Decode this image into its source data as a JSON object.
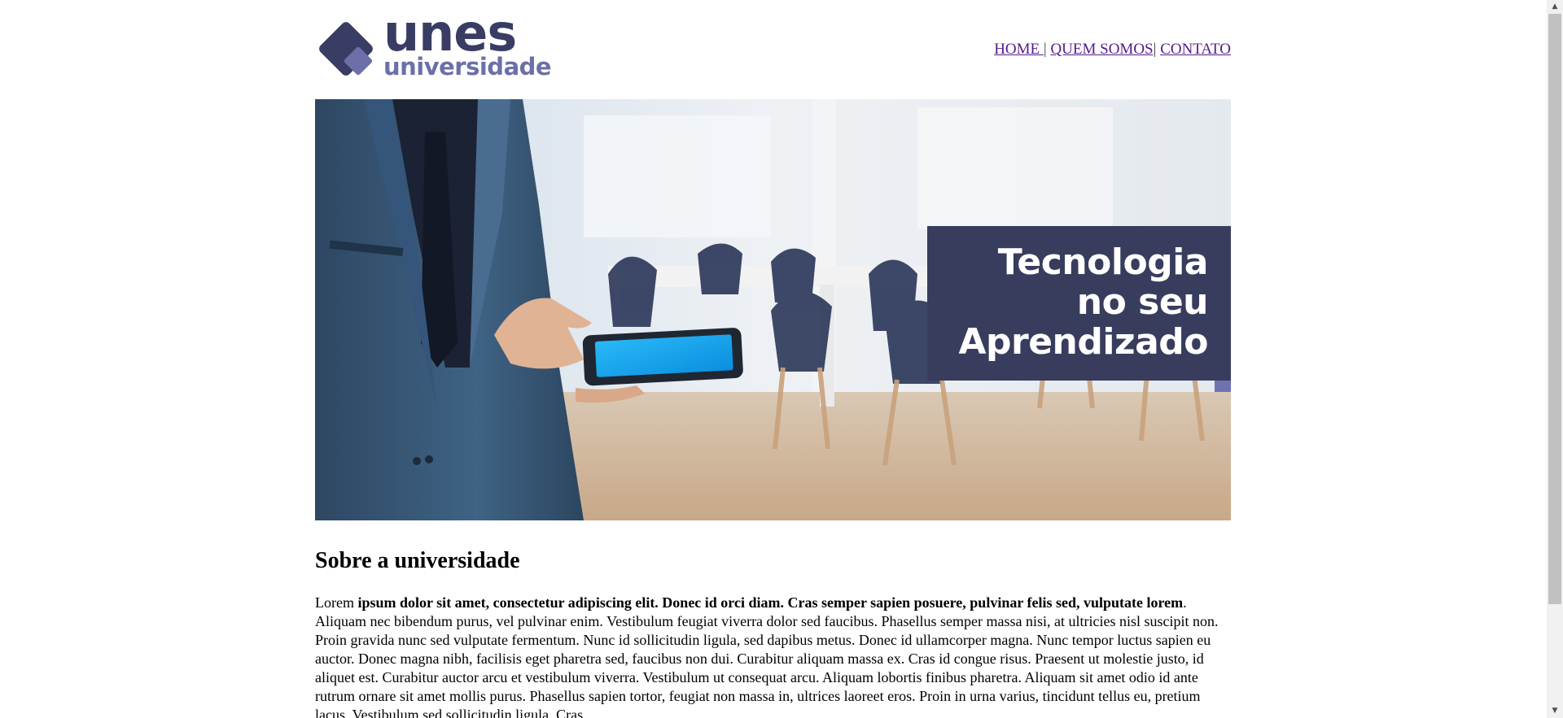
{
  "logo": {
    "main": "unes",
    "sub": "universidade"
  },
  "nav": {
    "items": [
      {
        "label": "HOME "
      },
      {
        "label": "QUEM SOMOS"
      },
      {
        "label": "CONTATO"
      }
    ],
    "separator": "|"
  },
  "banner": {
    "line1": "Tecnologia",
    "line2": "no seu",
    "line3": "Aprendizado"
  },
  "section": {
    "title": "Sobre a universidade",
    "lead_plain": "Lorem ",
    "lead_bold": "ipsum dolor sit amet, consectetur adipiscing elit. Donec id orci diam. Cras semper sapien posuere, pulvinar felis sed, vulputate lorem",
    "body": ". Aliquam nec bibendum purus, vel pulvinar enim. Vestibulum feugiat viverra dolor sed faucibus. Phasellus semper massa nisi, at ultricies nisl suscipit non. Proin gravida nunc sed vulputate fermentum. Nunc id sollicitudin ligula, sed dapibus metus. Donec id ullamcorper magna. Nunc tempor luctus sapien eu auctor. Donec magna nibh, facilisis eget pharetra sed, faucibus non dui. Curabitur aliquam massa ex. Cras id congue risus. Praesent ut molestie justo, id aliquet est. Curabitur auctor arcu et vestibulum viverra. Vestibulum ut consequat arcu. Aliquam lobortis finibus pharetra. Aliquam sit amet odio id ante rutrum ornare sit amet mollis purus. Phasellus sapien tortor, feugiat non massa in, ultrices laoreet eros. Proin in urna varius, tincidunt tellus eu, pretium lacus. Vestibulum sed sollicitudin ligula. Cras"
  },
  "colors": {
    "brand_dark": "#393d63",
    "brand_light": "#6c6fa8",
    "overlay": "#383d5d",
    "link": "#551a8b"
  },
  "icons": {
    "scroll_up": "▲",
    "scroll_down": "▼"
  }
}
